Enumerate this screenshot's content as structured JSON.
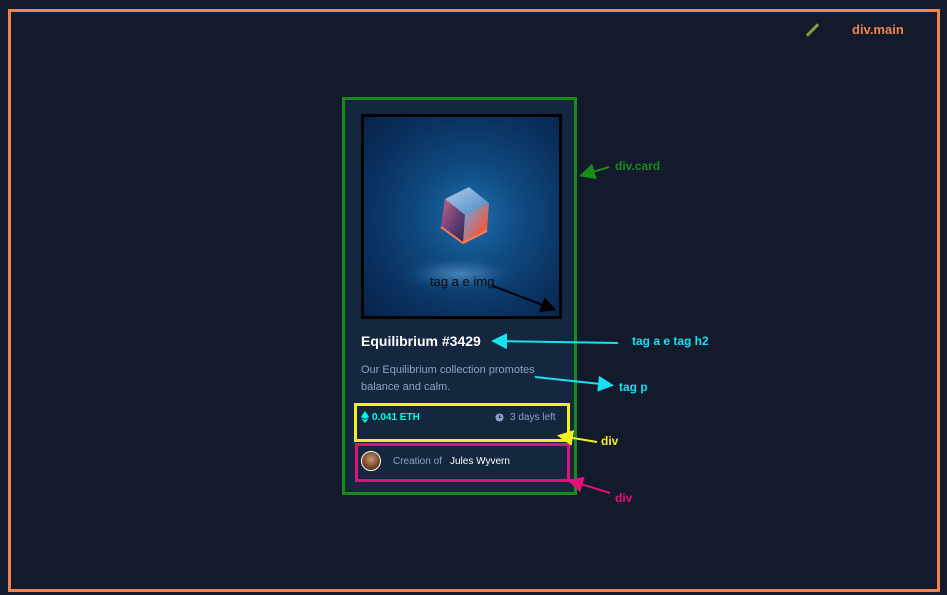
{
  "labels": {
    "main": "div.main",
    "card": "div.card",
    "img": "tag a e  img",
    "h2": "tag a e tag h2",
    "p": "tag p",
    "div_info": "div",
    "div_creator": "div"
  },
  "card": {
    "title": "Equilibrium #3429",
    "description": "Our Equilibrium collection promotes balance and calm.",
    "price": "0.041 ETH",
    "time_left": "3 days left",
    "creator_prefix": "Creation of",
    "creator_name": "Jules Wyvern"
  },
  "colors": {
    "main_border": "#f0834e",
    "card_border": "#1a8a1a",
    "info_border": "#f3f021",
    "creator_border": "#e0127a",
    "cyan": "#19e0f0"
  },
  "icons": [
    "ethereum-icon",
    "clock-icon",
    "avatar"
  ]
}
